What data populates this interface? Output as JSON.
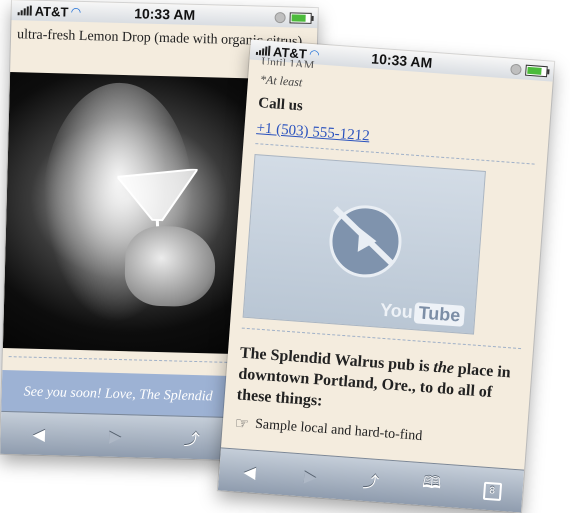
{
  "phone_a": {
    "status": {
      "carrier": "AT&T",
      "time": "10:33 AM"
    },
    "text": "ultra-fresh Lemon Drop (made with organic citrus).",
    "footer": "See you soon! Love, The Splendid",
    "toolbar": {
      "back": "◀",
      "forward": "▶",
      "share": "⤴",
      "bookmarks": "🕮"
    }
  },
  "phone_b": {
    "status": {
      "carrier": "AT&T",
      "time": "10:33 AM"
    },
    "cut_text": "Until 1AM",
    "at_least": "*At least",
    "call_us": "Call us",
    "phone_number": "+1 (503) 555-1212",
    "video": {
      "brand_you": "You",
      "brand_tube": "Tube"
    },
    "headline_before": "The Splendid Walrus pub is ",
    "headline_em": "the",
    "headline_after": " place in downtown Portland, Ore., to do all of these things:",
    "list_item": "Sample local and hard-to-find",
    "toolbar": {
      "back": "◀",
      "forward": "▶",
      "share": "⤴",
      "bookmarks": "🕮",
      "pages": "8"
    }
  }
}
